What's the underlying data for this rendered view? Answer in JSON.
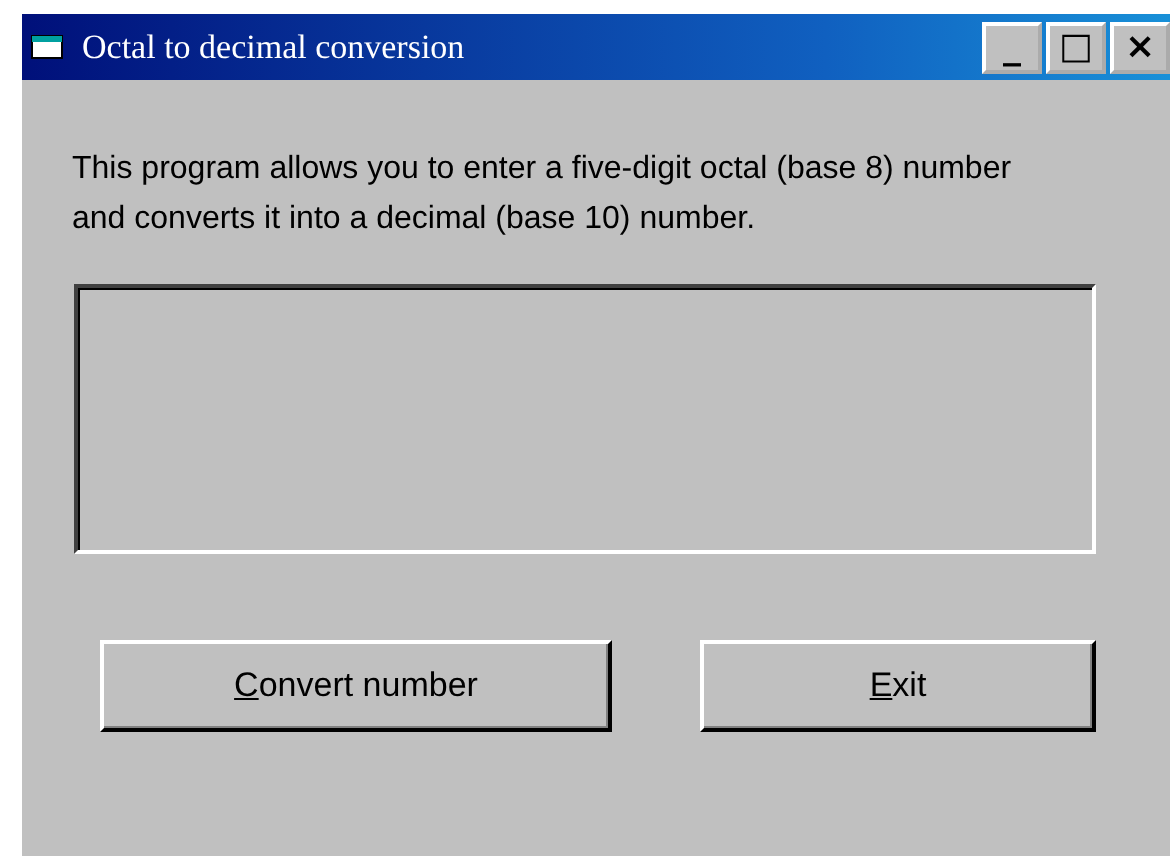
{
  "window": {
    "title": "Octal to decimal conversion",
    "controls": [
      "_",
      "□",
      "×"
    ]
  },
  "description": "This program allows you to enter a five-digit octal (base 8) number and converts it into a decimal (base 10) number.",
  "output_box": {
    "kind": "frame"
  },
  "buttons": [
    {
      "label": "Convert number",
      "underline_first": true
    },
    {
      "label": "Exit",
      "underline_first": true
    }
  ]
}
